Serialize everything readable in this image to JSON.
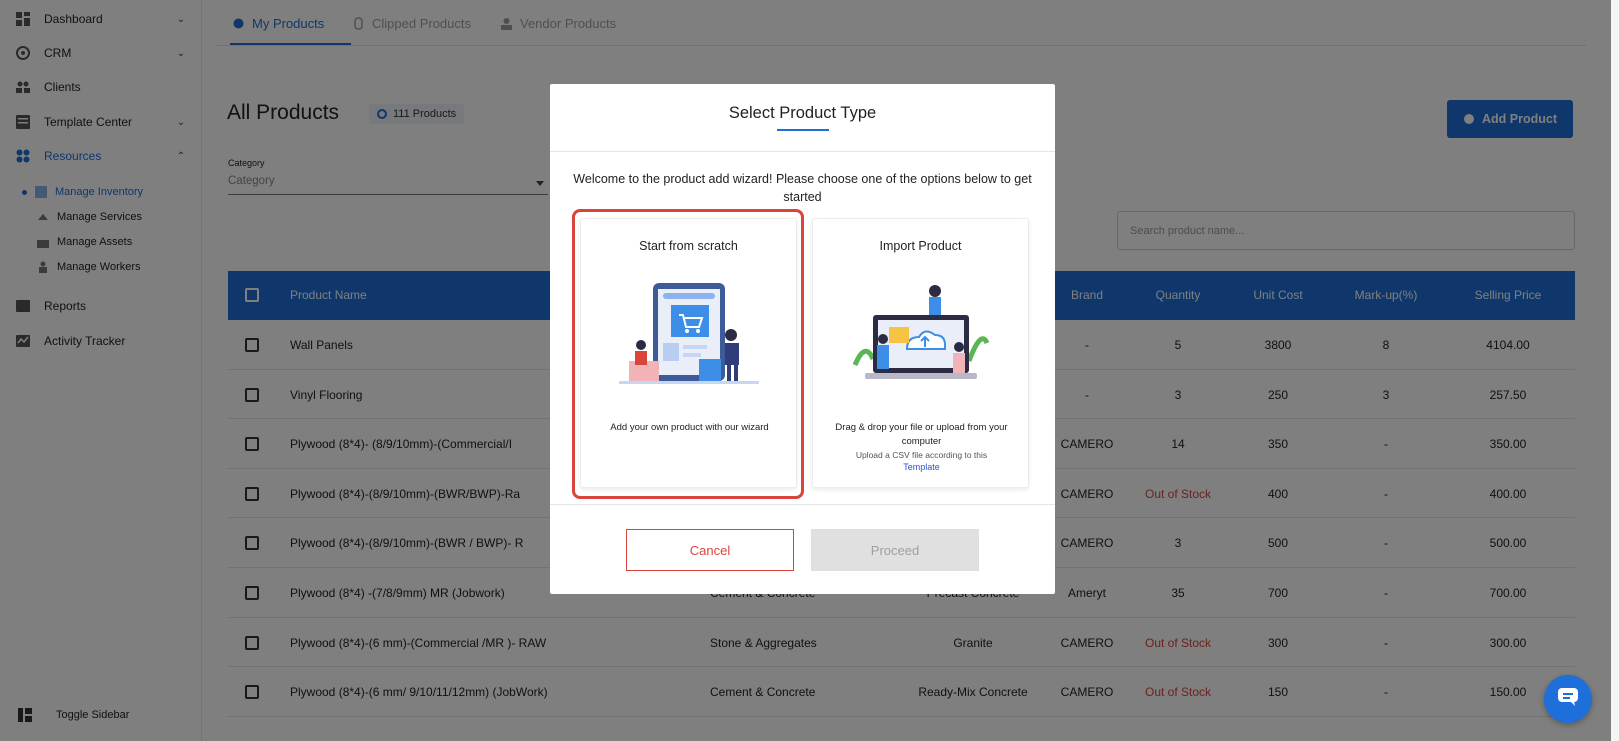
{
  "colors": {
    "accent": "#1e6fd9",
    "danger": "#d9443b"
  },
  "sidebar": {
    "items": [
      {
        "label": "Dashboard",
        "icon": "dashboard-icon"
      },
      {
        "label": "CRM",
        "icon": "crm-icon"
      },
      {
        "label": "Clients",
        "icon": "clients-icon"
      },
      {
        "label": "Template Center",
        "icon": "template-icon"
      },
      {
        "label": "Resources",
        "icon": "resources-icon"
      },
      {
        "label": "Reports",
        "icon": "reports-icon"
      },
      {
        "label": "Activity Tracker",
        "icon": "activity-icon"
      }
    ],
    "sub_items": [
      {
        "label": "Manage Inventory"
      },
      {
        "label": "Manage Services"
      },
      {
        "label": "Manage Assets"
      },
      {
        "label": "Manage Workers"
      }
    ],
    "toggle_label": "Toggle Sidebar"
  },
  "tabs": [
    {
      "label": "My Products"
    },
    {
      "label": "Clipped Products"
    },
    {
      "label": "Vendor Products"
    }
  ],
  "page": {
    "title": "All Products",
    "count_label": "111 Products",
    "add_button": "Add Product",
    "category_label": "Category",
    "category_placeholder": "Category",
    "search_placeholder": "Search product name..."
  },
  "table": {
    "headers": {
      "name": "Product Name",
      "brand": "Brand",
      "qty": "Quantity",
      "cost": "Unit Cost",
      "mark": "Mark-up(%)",
      "sell": "Selling Price"
    },
    "rows": [
      {
        "name": "Wall Panels",
        "cat": "",
        "sub": "",
        "brand": "-",
        "qty": "5",
        "cost": "3800",
        "mark": "8",
        "sell": "4104.00"
      },
      {
        "name": "Vinyl Flooring",
        "cat": "",
        "sub": "",
        "brand": "-",
        "qty": "3",
        "cost": "250",
        "mark": "3",
        "sell": "257.50"
      },
      {
        "name": "Plywood (8*4)- (8/9/10mm)-(Commercial/I",
        "cat": "",
        "sub": "",
        "brand": "CAMERO",
        "qty": "14",
        "cost": "350",
        "mark": "-",
        "sell": "350.00"
      },
      {
        "name": "Plywood (8*4)-(8/9/10mm)-(BWR/BWP)-Ra",
        "cat": "",
        "sub": "",
        "brand": "CAMERO",
        "qty": "Out of Stock",
        "cost": "400",
        "mark": "-",
        "sell": "400.00"
      },
      {
        "name": "Plywood (8*4)-(8/9/10mm)-(BWR / BWP)- R",
        "cat": "",
        "sub": "",
        "brand": "CAMERO",
        "qty": "3",
        "cost": "500",
        "mark": "-",
        "sell": "500.00"
      },
      {
        "name": "Plywood (8*4) -(7/8/9mm) MR (Jobwork)",
        "cat": "Cement & Concrete",
        "sub": "Precast Concrete",
        "brand": "Ameryt",
        "qty": "35",
        "cost": "700",
        "mark": "-",
        "sell": "700.00"
      },
      {
        "name": "Plywood (8*4)-(6 mm)-(Commercial /MR )- RAW",
        "cat": "Stone & Aggregates",
        "sub": "Granite",
        "brand": "CAMERO",
        "qty": "Out of Stock",
        "cost": "300",
        "mark": "-",
        "sell": "300.00"
      },
      {
        "name": "Plywood (8*4)-(6 mm/ 9/10/11/12mm) (JobWork)",
        "cat": "Cement & Concrete",
        "sub": "Ready-Mix Concrete",
        "brand": "CAMERO",
        "qty": "Out of Stock",
        "cost": "150",
        "mark": "-",
        "sell": "150.00"
      }
    ]
  },
  "modal": {
    "title": "Select Product Type",
    "welcome": "Welcome to the product add wizard! Please choose one of the options below to get started",
    "options": [
      {
        "title": "Start from scratch",
        "desc": "Add your own product with our wizard",
        "icon": "shopping-illustration-icon"
      },
      {
        "title": "Import Product",
        "desc": "Drag & drop your file or upload from your computer",
        "sub": "Upload a CSV file according to this",
        "link": "Template",
        "icon": "upload-illustration-icon"
      }
    ],
    "cancel": "Cancel",
    "proceed": "Proceed"
  },
  "chat_icon": "chat-icon"
}
